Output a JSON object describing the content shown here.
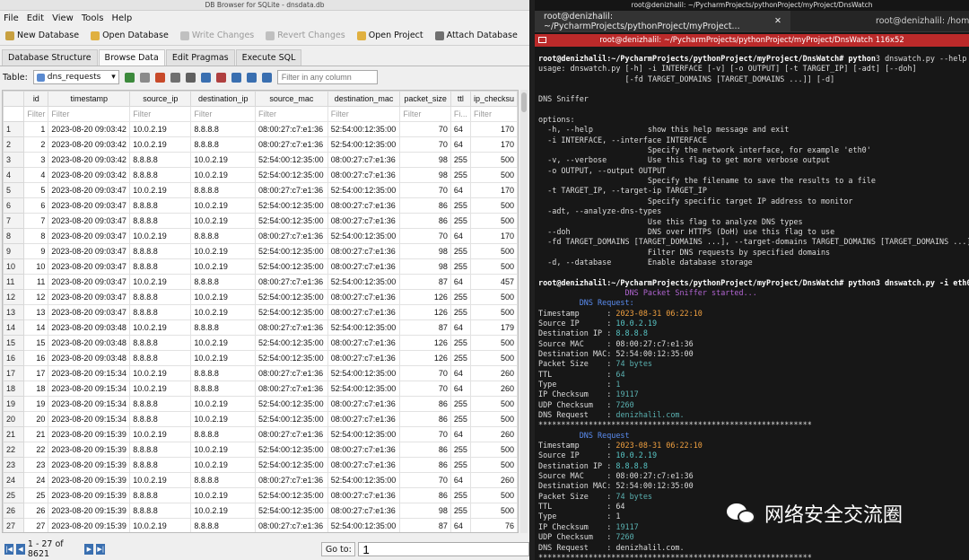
{
  "db": {
    "window_title": "DB Browser for SQLite - dnsdata.db",
    "menu": [
      "File",
      "Edit",
      "View",
      "Tools",
      "Help"
    ],
    "toolbar": [
      {
        "label": "New Database",
        "enabled": true,
        "color": "#c8a040"
      },
      {
        "label": "Open Database",
        "enabled": true,
        "color": "#e0b040"
      },
      {
        "label": "Write Changes",
        "enabled": false,
        "color": "#c0c0c0"
      },
      {
        "label": "Revert Changes",
        "enabled": false,
        "color": "#c0c0c0"
      },
      {
        "label": "Open Project",
        "enabled": true,
        "color": "#e0b040"
      },
      {
        "label": "Attach Database",
        "enabled": true,
        "color": "#707070"
      }
    ],
    "tabs": [
      "Database Structure",
      "Browse Data",
      "Edit Pragmas",
      "Execute SQL"
    ],
    "active_tab": "Browse Data",
    "table_label": "Table:",
    "table_value": "dns_requests",
    "filter_placeholder": "Filter in any column",
    "columns": [
      "id",
      "timestamp",
      "source_ip",
      "destination_ip",
      "source_mac",
      "destination_mac",
      "packet_size",
      "ttl",
      "ip_checksu"
    ],
    "filter_cells": [
      "Filter",
      "Filter",
      "Filter",
      "Filter",
      "Filter",
      "Filter",
      "Filter",
      "Fi...",
      "Filter"
    ],
    "rows": [
      [
        "1",
        "2023-08-20 09:03:42",
        "10.0.2.19",
        "8.8.8.8",
        "08:00:27:c7:e1:36",
        "52:54:00:12:35:00",
        "70",
        "64",
        "170"
      ],
      [
        "2",
        "2023-08-20 09:03:42",
        "10.0.2.19",
        "8.8.8.8",
        "08:00:27:c7:e1:36",
        "52:54:00:12:35:00",
        "70",
        "64",
        "170"
      ],
      [
        "3",
        "2023-08-20 09:03:42",
        "8.8.8.8",
        "10.0.2.19",
        "52:54:00:12:35:00",
        "08:00:27:c7:e1:36",
        "98",
        "255",
        "500"
      ],
      [
        "4",
        "2023-08-20 09:03:42",
        "8.8.8.8",
        "10.0.2.19",
        "52:54:00:12:35:00",
        "08:00:27:c7:e1:36",
        "98",
        "255",
        "500"
      ],
      [
        "5",
        "2023-08-20 09:03:47",
        "10.0.2.19",
        "8.8.8.8",
        "08:00:27:c7:e1:36",
        "52:54:00:12:35:00",
        "70",
        "64",
        "170"
      ],
      [
        "6",
        "2023-08-20 09:03:47",
        "8.8.8.8",
        "10.0.2.19",
        "52:54:00:12:35:00",
        "08:00:27:c7:e1:36",
        "86",
        "255",
        "500"
      ],
      [
        "7",
        "2023-08-20 09:03:47",
        "8.8.8.8",
        "10.0.2.19",
        "52:54:00:12:35:00",
        "08:00:27:c7:e1:36",
        "86",
        "255",
        "500"
      ],
      [
        "8",
        "2023-08-20 09:03:47",
        "10.0.2.19",
        "8.8.8.8",
        "08:00:27:c7:e1:36",
        "52:54:00:12:35:00",
        "70",
        "64",
        "170"
      ],
      [
        "9",
        "2023-08-20 09:03:47",
        "8.8.8.8",
        "10.0.2.19",
        "52:54:00:12:35:00",
        "08:00:27:c7:e1:36",
        "98",
        "255",
        "500"
      ],
      [
        "10",
        "2023-08-20 09:03:47",
        "8.8.8.8",
        "10.0.2.19",
        "52:54:00:12:35:00",
        "08:00:27:c7:e1:36",
        "98",
        "255",
        "500"
      ],
      [
        "11",
        "2023-08-20 09:03:47",
        "10.0.2.19",
        "8.8.8.8",
        "08:00:27:c7:e1:36",
        "52:54:00:12:35:00",
        "87",
        "64",
        "457"
      ],
      [
        "12",
        "2023-08-20 09:03:47",
        "8.8.8.8",
        "10.0.2.19",
        "52:54:00:12:35:00",
        "08:00:27:c7:e1:36",
        "126",
        "255",
        "500"
      ],
      [
        "13",
        "2023-08-20 09:03:47",
        "8.8.8.8",
        "10.0.2.19",
        "52:54:00:12:35:00",
        "08:00:27:c7:e1:36",
        "126",
        "255",
        "500"
      ],
      [
        "14",
        "2023-08-20 09:03:48",
        "10.0.2.19",
        "8.8.8.8",
        "08:00:27:c7:e1:36",
        "52:54:00:12:35:00",
        "87",
        "64",
        "179"
      ],
      [
        "15",
        "2023-08-20 09:03:48",
        "8.8.8.8",
        "10.0.2.19",
        "52:54:00:12:35:00",
        "08:00:27:c7:e1:36",
        "126",
        "255",
        "500"
      ],
      [
        "16",
        "2023-08-20 09:03:48",
        "8.8.8.8",
        "10.0.2.19",
        "52:54:00:12:35:00",
        "08:00:27:c7:e1:36",
        "126",
        "255",
        "500"
      ],
      [
        "17",
        "2023-08-20 09:15:34",
        "10.0.2.19",
        "8.8.8.8",
        "08:00:27:c7:e1:36",
        "52:54:00:12:35:00",
        "70",
        "64",
        "260"
      ],
      [
        "18",
        "2023-08-20 09:15:34",
        "10.0.2.19",
        "8.8.8.8",
        "08:00:27:c7:e1:36",
        "52:54:00:12:35:00",
        "70",
        "64",
        "260"
      ],
      [
        "19",
        "2023-08-20 09:15:34",
        "8.8.8.8",
        "10.0.2.19",
        "52:54:00:12:35:00",
        "08:00:27:c7:e1:36",
        "86",
        "255",
        "500"
      ],
      [
        "20",
        "2023-08-20 09:15:34",
        "8.8.8.8",
        "10.0.2.19",
        "52:54:00:12:35:00",
        "08:00:27:c7:e1:36",
        "86",
        "255",
        "500"
      ],
      [
        "21",
        "2023-08-20 09:15:39",
        "10.0.2.19",
        "8.8.8.8",
        "08:00:27:c7:e1:36",
        "52:54:00:12:35:00",
        "70",
        "64",
        "260"
      ],
      [
        "22",
        "2023-08-20 09:15:39",
        "8.8.8.8",
        "10.0.2.19",
        "52:54:00:12:35:00",
        "08:00:27:c7:e1:36",
        "86",
        "255",
        "500"
      ],
      [
        "23",
        "2023-08-20 09:15:39",
        "8.8.8.8",
        "10.0.2.19",
        "52:54:00:12:35:00",
        "08:00:27:c7:e1:36",
        "86",
        "255",
        "500"
      ],
      [
        "24",
        "2023-08-20 09:15:39",
        "10.0.2.19",
        "8.8.8.8",
        "08:00:27:c7:e1:36",
        "52:54:00:12:35:00",
        "70",
        "64",
        "260"
      ],
      [
        "25",
        "2023-08-20 09:15:39",
        "8.8.8.8",
        "10.0.2.19",
        "52:54:00:12:35:00",
        "08:00:27:c7:e1:36",
        "86",
        "255",
        "500"
      ],
      [
        "26",
        "2023-08-20 09:15:39",
        "8.8.8.8",
        "10.0.2.19",
        "52:54:00:12:35:00",
        "08:00:27:c7:e1:36",
        "98",
        "255",
        "500"
      ],
      [
        "27",
        "2023-08-20 09:15:39",
        "10.0.2.19",
        "8.8.8.8",
        "08:00:27:c7:e1:36",
        "52:54:00:12:35:00",
        "87",
        "64",
        "76"
      ]
    ],
    "record_text": "1 - 27 of 8621",
    "goto_label": "Go to:",
    "goto_value": "1"
  },
  "term": {
    "window_title": "root@denizhalil: ~/PycharmProjects/pythonProject/myProject/DnsWatch",
    "tab1": "root@denizhalil: ~/PycharmProjects/pythonProject/myProject...",
    "tab2": "root@denizhalil: /home/",
    "inner_title": "root@denizhalil: ~/PycharmProjects/pythonProject/myProject/DnsWatch 116x52",
    "lines": [
      [
        {
          "t": "root@denizhalil:~/PycharmProjects/pythonProject/myProject/DnsWatch# python",
          "c": "prompt"
        },
        {
          "t": "3 dnswatch.py --help",
          "c": ""
        }
      ],
      [
        {
          "t": "usage: dnswatch.py [-h] -i INTERFACE [-v] [-o OUTPUT] [-t TARGET_IP] [-adt] [--doh]",
          "c": ""
        }
      ],
      [
        {
          "t": "                   [-fd TARGET_DOMAINS [TARGET_DOMAINS ...]] [-d]",
          "c": ""
        }
      ],
      [
        {
          "t": "",
          "c": ""
        }
      ],
      [
        {
          "t": "DNS Sniffer",
          "c": ""
        }
      ],
      [
        {
          "t": "",
          "c": ""
        }
      ],
      [
        {
          "t": "options:",
          "c": ""
        }
      ],
      [
        {
          "t": "  -h, --help            show this help message and exit",
          "c": ""
        }
      ],
      [
        {
          "t": "  -i INTERFACE, --interface INTERFACE",
          "c": ""
        }
      ],
      [
        {
          "t": "                        Specify the network interface, for example 'eth0'",
          "c": ""
        }
      ],
      [
        {
          "t": "  -v, --verbose         Use this flag to get more verbose output",
          "c": ""
        }
      ],
      [
        {
          "t": "  -o OUTPUT, --output OUTPUT",
          "c": ""
        }
      ],
      [
        {
          "t": "                        Specify the filename to save the results to a file",
          "c": ""
        }
      ],
      [
        {
          "t": "  -t TARGET_IP, --target-ip TARGET_IP",
          "c": ""
        }
      ],
      [
        {
          "t": "                        Specify specific target IP address to monitor",
          "c": ""
        }
      ],
      [
        {
          "t": "  -adt, --analyze-dns-types",
          "c": ""
        }
      ],
      [
        {
          "t": "                        Use this flag to analyze DNS types",
          "c": ""
        }
      ],
      [
        {
          "t": "  --doh                 DNS over HTTPS (DoH) use this flag to use",
          "c": ""
        }
      ],
      [
        {
          "t": "  -fd TARGET_DOMAINS [TARGET_DOMAINS ...], --target-domains TARGET_DOMAINS [TARGET_DOMAINS ...]",
          "c": ""
        }
      ],
      [
        {
          "t": "                        Filter DNS requests by specified domains",
          "c": ""
        }
      ],
      [
        {
          "t": "  -d, --database        Enable database storage",
          "c": ""
        }
      ],
      [
        {
          "t": "",
          "c": ""
        }
      ],
      [
        {
          "t": "root@denizhalil:~/PycharmProjects/pythonProject/myProject/DnsWatch# python3 dnswatch.py -i eth0",
          "c": "prompt"
        }
      ],
      [
        {
          "t": "                   DNS Packet Sniffer started...",
          "c": "purple"
        }
      ],
      [
        {
          "t": "         DNS Request:",
          "c": "blue"
        }
      ],
      [
        {
          "t": "Timestamp      : ",
          "c": ""
        },
        {
          "t": "2023-08-31 06:22:10",
          "c": "orange"
        }
      ],
      [
        {
          "t": "Source IP      : ",
          "c": ""
        },
        {
          "t": "10.0.2.19",
          "c": "cyan"
        }
      ],
      [
        {
          "t": "Destination IP : ",
          "c": ""
        },
        {
          "t": "8.8.8.8",
          "c": "cyan"
        }
      ],
      [
        {
          "t": "Source MAC     : 08:00:27:c7:e1:36",
          "c": ""
        }
      ],
      [
        {
          "t": "Destination MAC: 52:54:00:12:35:00",
          "c": ""
        }
      ],
      [
        {
          "t": "Packet Size    : ",
          "c": ""
        },
        {
          "t": "74 bytes",
          "c": "teal"
        }
      ],
      [
        {
          "t": "TTL            : ",
          "c": ""
        },
        {
          "t": "64",
          "c": "teal"
        }
      ],
      [
        {
          "t": "Type           : ",
          "c": ""
        },
        {
          "t": "1",
          "c": "teal"
        }
      ],
      [
        {
          "t": "IP Checksum    : ",
          "c": ""
        },
        {
          "t": "19117",
          "c": "teal"
        }
      ],
      [
        {
          "t": "UDP Checksum   : ",
          "c": ""
        },
        {
          "t": "7260",
          "c": "teal"
        }
      ],
      [
        {
          "t": "DNS Request    : ",
          "c": ""
        },
        {
          "t": "denizhalil.com.",
          "c": "teal"
        }
      ],
      [
        {
          "t": "************************************************************",
          "c": ""
        }
      ],
      [
        {
          "t": "         DNS Request",
          "c": "blue"
        }
      ],
      [
        {
          "t": "Timestamp      : ",
          "c": ""
        },
        {
          "t": "2023-08-31 06:22:10",
          "c": "orange"
        }
      ],
      [
        {
          "t": "Source IP      : ",
          "c": ""
        },
        {
          "t": "10.0.2.19",
          "c": "cyan"
        }
      ],
      [
        {
          "t": "Destination IP : ",
          "c": ""
        },
        {
          "t": "8.8.8.8",
          "c": "cyan"
        }
      ],
      [
        {
          "t": "Source MAC     : 08:00:27:c7:e1:36",
          "c": ""
        }
      ],
      [
        {
          "t": "Destination MAC: 52:54:00:12:35:00",
          "c": ""
        }
      ],
      [
        {
          "t": "Packet Size    : ",
          "c": ""
        },
        {
          "t": "74 bytes",
          "c": "teal"
        }
      ],
      [
        {
          "t": "TTL            : 64",
          "c": ""
        }
      ],
      [
        {
          "t": "Type           : 1",
          "c": ""
        }
      ],
      [
        {
          "t": "IP Checksum    : ",
          "c": ""
        },
        {
          "t": "19117",
          "c": "teal"
        }
      ],
      [
        {
          "t": "UDP Checksum   : ",
          "c": ""
        },
        {
          "t": "7260",
          "c": "teal"
        }
      ],
      [
        {
          "t": "DNS Request    : denizhalil.com.",
          "c": ""
        }
      ],
      [
        {
          "t": "************************************************************",
          "c": ""
        }
      ]
    ]
  },
  "watermark": "网络安全交流圈"
}
